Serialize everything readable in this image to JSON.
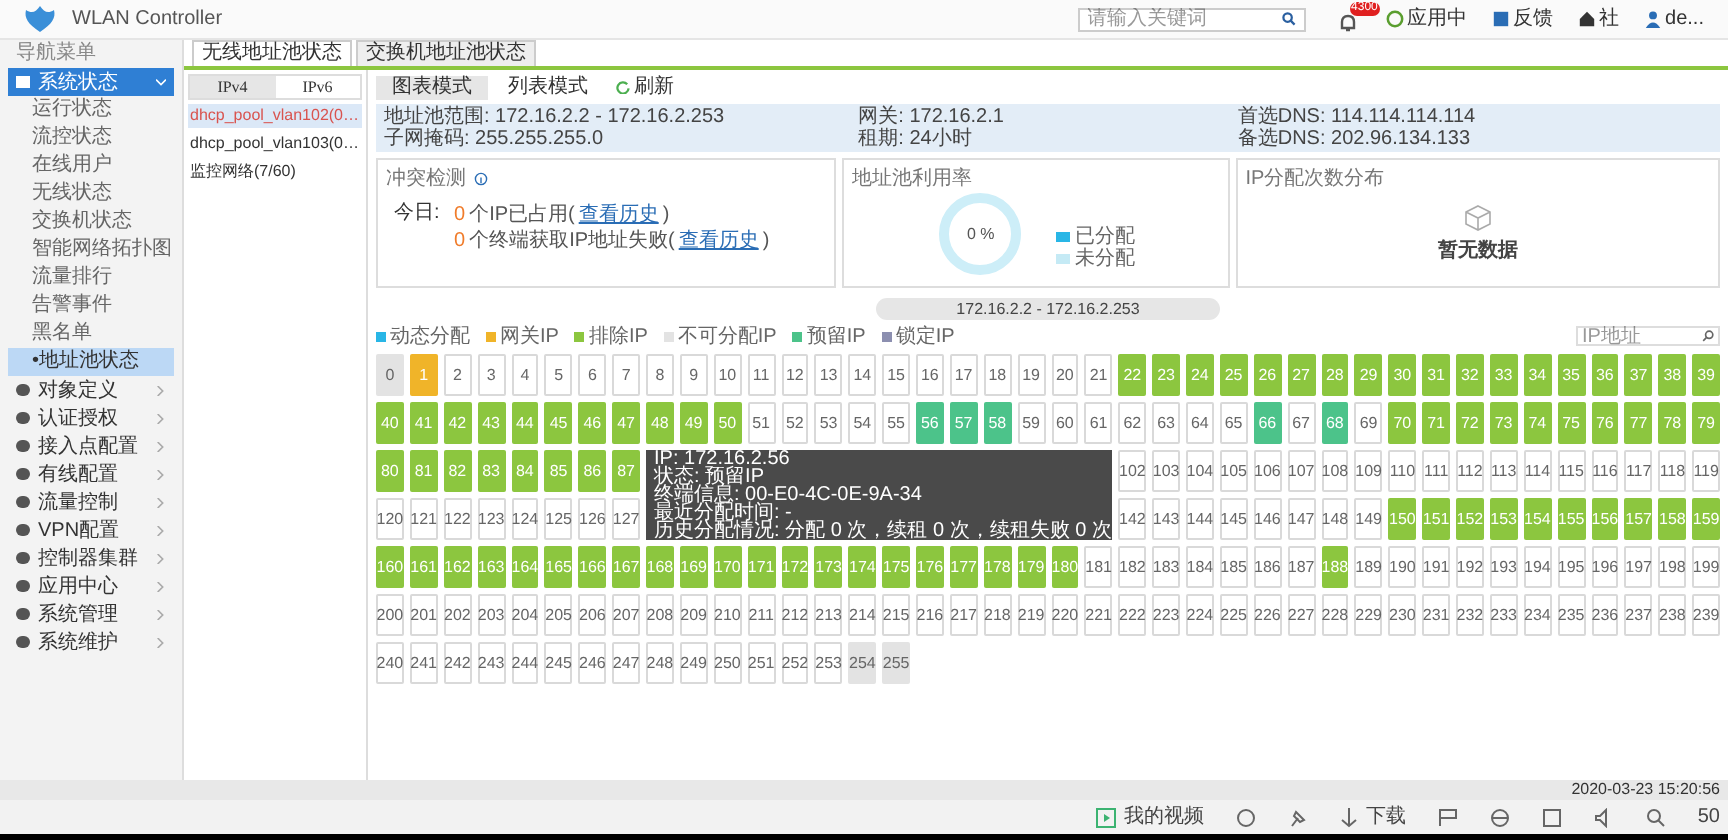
{
  "header": {
    "title": "WLAN Controller",
    "search": {
      "placeholder": "请输入关键词"
    },
    "badge": "4300",
    "actions": [
      {
        "kind": "app",
        "label": "应用中"
      },
      {
        "kind": "feedback",
        "label": "反馈"
      },
      {
        "kind": "community",
        "label": "社"
      },
      {
        "kind": "user",
        "label": "de..."
      }
    ]
  },
  "sidebar": {
    "title": "导航菜单",
    "groups": [
      {
        "label": "系统状态",
        "expanded": true,
        "children": [
          {
            "label": "运行状态",
            "selected": false
          },
          {
            "label": "流控状态",
            "selected": false
          },
          {
            "label": "在线用户",
            "selected": false
          },
          {
            "label": "无线状态",
            "selected": false
          },
          {
            "label": "交换机状态",
            "selected": false
          },
          {
            "label": "智能网络拓扑图",
            "selected": false
          },
          {
            "label": "流量排行",
            "selected": false
          },
          {
            "label": "告警事件",
            "selected": false
          },
          {
            "label": "黑名单",
            "selected": false
          },
          {
            "label": "•地址池状态",
            "selected": true
          }
        ]
      },
      {
        "label": "对象定义",
        "expanded": false
      },
      {
        "label": "认证授权",
        "expanded": false
      },
      {
        "label": "接入点配置",
        "expanded": false
      },
      {
        "label": "有线配置",
        "expanded": false
      },
      {
        "label": "流量控制",
        "expanded": false
      },
      {
        "label": "VPN配置",
        "expanded": false
      },
      {
        "label": "控制器集群",
        "expanded": false
      },
      {
        "label": "应用中心",
        "expanded": false
      },
      {
        "label": "系统管理",
        "expanded": false
      },
      {
        "label": "系统维护",
        "expanded": false
      }
    ]
  },
  "tabs": [
    {
      "label": "无线地址池状态",
      "selected": true
    },
    {
      "label": "交换机地址池状态",
      "selected": false
    }
  ],
  "tree": {
    "tabs": [
      {
        "label": "IPv4",
        "selected": true
      },
      {
        "label": "IPv6",
        "selected": false
      }
    ],
    "items": [
      {
        "label": "dhcp_pool_vlan102(0…",
        "selected": true
      },
      {
        "label": "dhcp_pool_vlan103(0…",
        "selected": false
      },
      {
        "label": "监控网络(7/60)",
        "selected": false
      }
    ]
  },
  "view_tabs": [
    {
      "label": "图表模式",
      "selected": true
    },
    {
      "label": "列表模式",
      "selected": false
    }
  ],
  "refresh": "刷新",
  "info": [
    [
      "地址池范围: 172.16.2.2 - 172.16.2.253",
      "子网掩码: 255.255.255.0"
    ],
    [
      "网关: 172.16.2.1",
      "租期: 24小时"
    ],
    [
      "首选DNS: 114.114.114.114",
      "备选DNS: 202.96.134.133"
    ]
  ],
  "conflict": {
    "title": "冲突检测",
    "today": "今日:",
    "lines": [
      {
        "count": "0",
        "text": "个IP已占用(",
        "link": "查看历史",
        "close": ")"
      },
      {
        "count": "0",
        "text": "个终端获取IP地址失败(",
        "link": "查看历史",
        "close": ")"
      }
    ]
  },
  "usage": {
    "title": "地址池利用率",
    "value": "0 %",
    "legend": [
      {
        "label": "已分配",
        "color": "#29b6e6"
      },
      {
        "label": "未分配",
        "color": "#c5eaf5"
      }
    ]
  },
  "distribution": {
    "title": "IP分配次数分布",
    "empty": "暂无数据"
  },
  "range": "172.16.2.2 - 172.16.2.253",
  "ip_search": {
    "placeholder": "IP地址"
  },
  "legend": [
    {
      "label": "动态分配",
      "color": "#29b6e6"
    },
    {
      "label": "网关IP",
      "color": "#f0b429"
    },
    {
      "label": "排除IP",
      "color": "#8cc63f"
    },
    {
      "label": "不可分配IP",
      "color": "#e3e3e3"
    },
    {
      "label": "预留IP",
      "color": "#4cc38a"
    },
    {
      "label": "锁定IP",
      "color": "#8c8fb0"
    }
  ],
  "cells": [
    {
      "label": "0",
      "kind": "unavailable"
    },
    {
      "label": "1",
      "kind": "gateway"
    },
    {
      "label": "2",
      "kind": "free"
    },
    {
      "label": "3",
      "kind": "free"
    },
    {
      "label": "4",
      "kind": "free"
    },
    {
      "label": "5",
      "kind": "free"
    },
    {
      "label": "6",
      "kind": "free"
    },
    {
      "label": "7",
      "kind": "free"
    },
    {
      "label": "8",
      "kind": "free"
    },
    {
      "label": "9",
      "kind": "free"
    },
    {
      "label": "10",
      "kind": "free"
    },
    {
      "label": "11",
      "kind": "free"
    },
    {
      "label": "12",
      "kind": "free"
    },
    {
      "label": "13",
      "kind": "free"
    },
    {
      "label": "14",
      "kind": "free"
    },
    {
      "label": "15",
      "kind": "free"
    },
    {
      "label": "16",
      "kind": "free"
    },
    {
      "label": "17",
      "kind": "free"
    },
    {
      "label": "18",
      "kind": "free"
    },
    {
      "label": "19",
      "kind": "free"
    },
    {
      "label": "20",
      "kind": "free"
    },
    {
      "label": "21",
      "kind": "free"
    },
    {
      "label": "22",
      "kind": "excluded"
    },
    {
      "label": "23",
      "kind": "excluded"
    },
    {
      "label": "24",
      "kind": "excluded"
    },
    {
      "label": "25",
      "kind": "excluded"
    },
    {
      "label": "26",
      "kind": "excluded"
    },
    {
      "label": "27",
      "kind": "excluded"
    },
    {
      "label": "28",
      "kind": "excluded"
    },
    {
      "label": "29",
      "kind": "excluded"
    },
    {
      "label": "30",
      "kind": "excluded"
    },
    {
      "label": "31",
      "kind": "excluded"
    },
    {
      "label": "32",
      "kind": "excluded"
    },
    {
      "label": "33",
      "kind": "excluded"
    },
    {
      "label": "34",
      "kind": "excluded"
    },
    {
      "label": "35",
      "kind": "excluded"
    },
    {
      "label": "36",
      "kind": "excluded"
    },
    {
      "label": "37",
      "kind": "excluded"
    },
    {
      "label": "38",
      "kind": "excluded"
    },
    {
      "label": "39",
      "kind": "excluded"
    },
    {
      "label": "40",
      "kind": "excluded"
    },
    {
      "label": "41",
      "kind": "excluded"
    },
    {
      "label": "42",
      "kind": "excluded"
    },
    {
      "label": "43",
      "kind": "excluded"
    },
    {
      "label": "44",
      "kind": "excluded"
    },
    {
      "label": "45",
      "kind": "excluded"
    },
    {
      "label": "46",
      "kind": "excluded"
    },
    {
      "label": "47",
      "kind": "excluded"
    },
    {
      "label": "48",
      "kind": "excluded"
    },
    {
      "label": "49",
      "kind": "excluded"
    },
    {
      "label": "50",
      "kind": "excluded"
    },
    {
      "label": "51",
      "kind": "free"
    },
    {
      "label": "52",
      "kind": "free"
    },
    {
      "label": "53",
      "kind": "free"
    },
    {
      "label": "54",
      "kind": "free"
    },
    {
      "label": "55",
      "kind": "free"
    },
    {
      "label": "56",
      "kind": "reserved"
    },
    {
      "label": "57",
      "kind": "reserved"
    },
    {
      "label": "58",
      "kind": "reserved"
    },
    {
      "label": "59",
      "kind": "free"
    },
    {
      "label": "60",
      "kind": "free"
    },
    {
      "label": "61",
      "kind": "free"
    },
    {
      "label": "62",
      "kind": "free"
    },
    {
      "label": "63",
      "kind": "free"
    },
    {
      "label": "64",
      "kind": "free"
    },
    {
      "label": "65",
      "kind": "free"
    },
    {
      "label": "66",
      "kind": "reserved"
    },
    {
      "label": "67",
      "kind": "free"
    },
    {
      "label": "68",
      "kind": "reserved"
    },
    {
      "label": "69",
      "kind": "free"
    },
    {
      "label": "70",
      "kind": "excluded"
    },
    {
      "label": "71",
      "kind": "excluded"
    },
    {
      "label": "72",
      "kind": "excluded"
    },
    {
      "label": "73",
      "kind": "excluded"
    },
    {
      "label": "74",
      "kind": "excluded"
    },
    {
      "label": "75",
      "kind": "excluded"
    },
    {
      "label": "76",
      "kind": "excluded"
    },
    {
      "label": "77",
      "kind": "excluded"
    },
    {
      "label": "78",
      "kind": "excluded"
    },
    {
      "label": "79",
      "kind": "excluded"
    },
    {
      "label": "80",
      "kind": "excluded"
    },
    {
      "label": "81",
      "kind": "excluded"
    },
    {
      "label": "82",
      "kind": "excluded"
    },
    {
      "label": "83",
      "kind": "excluded"
    },
    {
      "label": "84",
      "kind": "excluded"
    },
    {
      "label": "85",
      "kind": "excluded"
    },
    {
      "label": "86",
      "kind": "excluded"
    },
    {
      "label": "87",
      "kind": "excluded"
    },
    {
      "label": "102",
      "kind": "free"
    },
    {
      "label": "103",
      "kind": "free"
    },
    {
      "label": "104",
      "kind": "free"
    },
    {
      "label": "105",
      "kind": "free"
    },
    {
      "label": "106",
      "kind": "free"
    },
    {
      "label": "107",
      "kind": "free"
    },
    {
      "label": "108",
      "kind": "free"
    },
    {
      "label": "109",
      "kind": "free"
    },
    {
      "label": "110",
      "kind": "free"
    },
    {
      "label": "111",
      "kind": "free"
    },
    {
      "label": "112",
      "kind": "free"
    },
    {
      "label": "113",
      "kind": "free"
    },
    {
      "label": "114",
      "kind": "free"
    },
    {
      "label": "115",
      "kind": "free"
    },
    {
      "label": "116",
      "kind": "free"
    },
    {
      "label": "117",
      "kind": "free"
    },
    {
      "label": "118",
      "kind": "free"
    },
    {
      "label": "119",
      "kind": "free"
    },
    {
      "label": "120",
      "kind": "free"
    },
    {
      "label": "121",
      "kind": "free"
    },
    {
      "label": "122",
      "kind": "free"
    },
    {
      "label": "123",
      "kind": "free"
    },
    {
      "label": "124",
      "kind": "free"
    },
    {
      "label": "125",
      "kind": "free"
    },
    {
      "label": "126",
      "kind": "free"
    },
    {
      "label": "127",
      "kind": "free"
    },
    {
      "label": "142",
      "kind": "free"
    },
    {
      "label": "143",
      "kind": "free"
    },
    {
      "label": "144",
      "kind": "free"
    },
    {
      "label": "145",
      "kind": "free"
    },
    {
      "label": "146",
      "kind": "free"
    },
    {
      "label": "147",
      "kind": "free"
    },
    {
      "label": "148",
      "kind": "free"
    },
    {
      "label": "149",
      "kind": "free"
    },
    {
      "label": "150",
      "kind": "excluded"
    },
    {
      "label": "151",
      "kind": "excluded"
    },
    {
      "label": "152",
      "kind": "excluded"
    },
    {
      "label": "153",
      "kind": "excluded"
    },
    {
      "label": "154",
      "kind": "excluded"
    },
    {
      "label": "155",
      "kind": "excluded"
    },
    {
      "label": "156",
      "kind": "excluded"
    },
    {
      "label": "157",
      "kind": "excluded"
    },
    {
      "label": "158",
      "kind": "excluded"
    },
    {
      "label": "159",
      "kind": "excluded"
    },
    {
      "label": "160",
      "kind": "excluded"
    },
    {
      "label": "161",
      "kind": "excluded"
    },
    {
      "label": "162",
      "kind": "excluded"
    },
    {
      "label": "163",
      "kind": "excluded"
    },
    {
      "label": "164",
      "kind": "excluded"
    },
    {
      "label": "165",
      "kind": "excluded"
    },
    {
      "label": "166",
      "kind": "excluded"
    },
    {
      "label": "167",
      "kind": "excluded"
    },
    {
      "label": "168",
      "kind": "excluded"
    },
    {
      "label": "169",
      "kind": "excluded"
    },
    {
      "label": "170",
      "kind": "excluded"
    },
    {
      "label": "171",
      "kind": "excluded"
    },
    {
      "label": "172",
      "kind": "excluded"
    },
    {
      "label": "173",
      "kind": "excluded"
    },
    {
      "label": "174",
      "kind": "excluded"
    },
    {
      "label": "175",
      "kind": "excluded"
    },
    {
      "label": "176",
      "kind": "excluded"
    },
    {
      "label": "177",
      "kind": "excluded"
    },
    {
      "label": "178",
      "kind": "excluded"
    },
    {
      "label": "179",
      "kind": "excluded"
    },
    {
      "label": "180",
      "kind": "excluded"
    },
    {
      "label": "181",
      "kind": "free"
    },
    {
      "label": "182",
      "kind": "free"
    },
    {
      "label": "183",
      "kind": "free"
    },
    {
      "label": "184",
      "kind": "free"
    },
    {
      "label": "185",
      "kind": "free"
    },
    {
      "label": "186",
      "kind": "free"
    },
    {
      "label": "187",
      "kind": "free"
    },
    {
      "label": "188",
      "kind": "excluded"
    },
    {
      "label": "189",
      "kind": "free"
    },
    {
      "label": "190",
      "kind": "free"
    },
    {
      "label": "191",
      "kind": "free"
    },
    {
      "label": "192",
      "kind": "free"
    },
    {
      "label": "193",
      "kind": "free"
    },
    {
      "label": "194",
      "kind": "free"
    },
    {
      "label": "195",
      "kind": "free"
    },
    {
      "label": "196",
      "kind": "free"
    },
    {
      "label": "197",
      "kind": "free"
    },
    {
      "label": "198",
      "kind": "free"
    },
    {
      "label": "199",
      "kind": "free"
    },
    {
      "label": "200",
      "kind": "free"
    },
    {
      "label": "201",
      "kind": "free"
    },
    {
      "label": "202",
      "kind": "free"
    },
    {
      "label": "203",
      "kind": "free"
    },
    {
      "label": "204",
      "kind": "free"
    },
    {
      "label": "205",
      "kind": "free"
    },
    {
      "label": "206",
      "kind": "free"
    },
    {
      "label": "207",
      "kind": "free"
    },
    {
      "label": "208",
      "kind": "free"
    },
    {
      "label": "209",
      "kind": "free"
    },
    {
      "label": "210",
      "kind": "free"
    },
    {
      "label": "211",
      "kind": "free"
    },
    {
      "label": "212",
      "kind": "free"
    },
    {
      "label": "213",
      "kind": "free"
    },
    {
      "label": "214",
      "kind": "free"
    },
    {
      "label": "215",
      "kind": "free"
    },
    {
      "label": "216",
      "kind": "free"
    },
    {
      "label": "217",
      "kind": "free"
    },
    {
      "label": "218",
      "kind": "free"
    },
    {
      "label": "219",
      "kind": "free"
    },
    {
      "label": "220",
      "kind": "free"
    },
    {
      "label": "221",
      "kind": "free"
    },
    {
      "label": "222",
      "kind": "free"
    },
    {
      "label": "223",
      "kind": "free"
    },
    {
      "label": "224",
      "kind": "free"
    },
    {
      "label": "225",
      "kind": "free"
    },
    {
      "label": "226",
      "kind": "free"
    },
    {
      "label": "227",
      "kind": "free"
    },
    {
      "label": "228",
      "kind": "free"
    },
    {
      "label": "229",
      "kind": "free"
    },
    {
      "label": "230",
      "kind": "free"
    },
    {
      "label": "231",
      "kind": "free"
    },
    {
      "label": "232",
      "kind": "free"
    },
    {
      "label": "233",
      "kind": "free"
    },
    {
      "label": "234",
      "kind": "free"
    },
    {
      "label": "235",
      "kind": "free"
    },
    {
      "label": "236",
      "kind": "free"
    },
    {
      "label": "237",
      "kind": "free"
    },
    {
      "label": "238",
      "kind": "free"
    },
    {
      "label": "239",
      "kind": "free"
    },
    {
      "label": "240",
      "kind": "free"
    },
    {
      "label": "241",
      "kind": "free"
    },
    {
      "label": "242",
      "kind": "free"
    },
    {
      "label": "243",
      "kind": "free"
    },
    {
      "label": "244",
      "kind": "free"
    },
    {
      "label": "245",
      "kind": "free"
    },
    {
      "label": "246",
      "kind": "free"
    },
    {
      "label": "247",
      "kind": "free"
    },
    {
      "label": "248",
      "kind": "free"
    },
    {
      "label": "249",
      "kind": "free"
    },
    {
      "label": "250",
      "kind": "free"
    },
    {
      "label": "251",
      "kind": "free"
    },
    {
      "label": "252",
      "kind": "free"
    },
    {
      "label": "253",
      "kind": "free"
    },
    {
      "label": "254",
      "kind": "unavailable"
    },
    {
      "label": "255",
      "kind": "unavailable"
    }
  ],
  "tooltip": [
    "IP: 172.16.2.56",
    "状态: 预留IP",
    "终端信息: 00-E0-4C-0E-9A-34",
    "最近分配时间: -",
    "历史分配情况: 分配 0 次，续租 0 次，续租失败 0 次"
  ],
  "status_time": "2020-03-23 15:20:56",
  "player": {
    "videos": "我的视频",
    "download": "下载",
    "zoom": "50"
  }
}
